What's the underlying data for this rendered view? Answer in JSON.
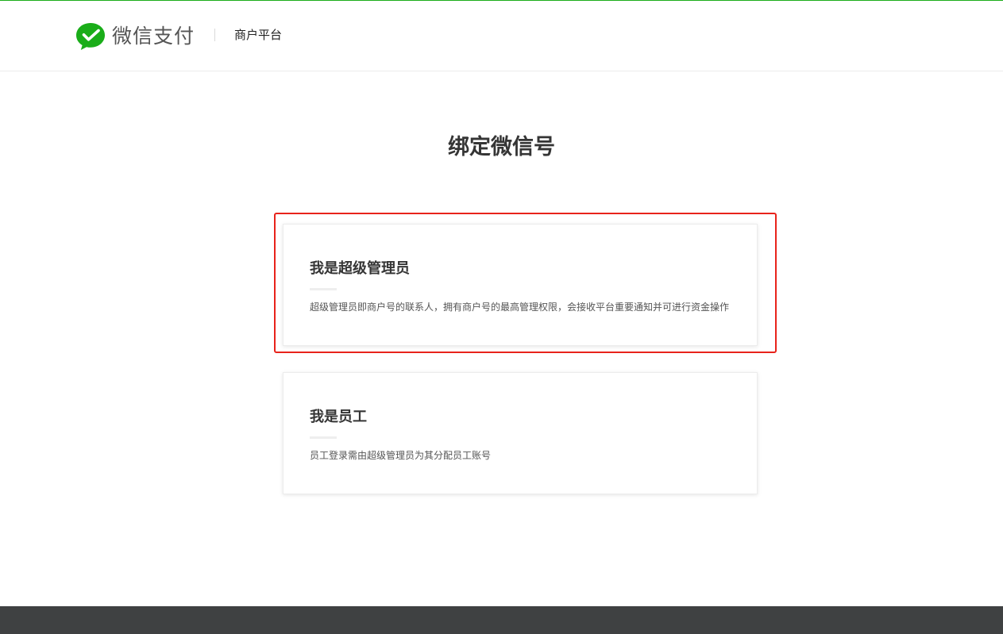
{
  "header": {
    "brand_text": "微信支付",
    "platform_label": "商户平台",
    "accent_color": "#1aad19"
  },
  "main": {
    "title": "绑定微信号",
    "cards": [
      {
        "title": "我是超级管理员",
        "description": "超级管理员即商户号的联系人，拥有商户号的最高管理权限，会接收平台重要通知并可进行资金操作",
        "highlighted": true
      },
      {
        "title": "我是员工",
        "description": "员工登录需由超级管理员为其分配员工账号",
        "highlighted": false
      }
    ]
  },
  "icons": {
    "logo": "wechat-pay-logo-icon"
  },
  "colors": {
    "highlight_border": "#e8231b",
    "footer_bg": "#3f4142"
  }
}
